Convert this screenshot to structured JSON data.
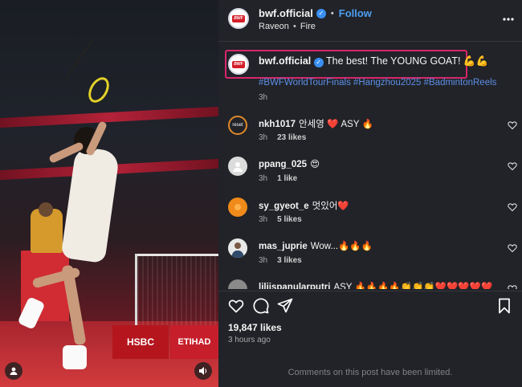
{
  "header": {
    "username": "bwf.official",
    "follow_label": "Follow",
    "audio": "Raveon",
    "audio_track": "Fire",
    "avatar_text": "BWF"
  },
  "caption": {
    "username": "bwf.official",
    "text": "The best! The YOUNG GOAT! 💪💪",
    "hashtags": "#BWFWorldTourFinals #Hangzhou2025 #BadmintonReels",
    "time": "3h"
  },
  "comments": [
    {
      "username": "nkh1017",
      "text": "안세영 ❤️ ASY 🔥",
      "time": "3h",
      "likes": "23 likes",
      "avatar_color": "#2a2a2a",
      "avatar_label": "reset"
    },
    {
      "username": "ppang_025",
      "text": "😍",
      "time": "3h",
      "likes": "1 like",
      "avatar_color": "#dcdcdc",
      "avatar_label": ""
    },
    {
      "username": "sy_gyeot_e",
      "text": "멋있어❤️",
      "time": "3h",
      "likes": "5 likes",
      "avatar_color": "#f08a1a",
      "avatar_label": ""
    },
    {
      "username": "mas_juprie",
      "text": "Wow...🔥🔥🔥",
      "time": "3h",
      "likes": "3 likes",
      "avatar_color": "#5b7c6a",
      "avatar_label": ""
    },
    {
      "username": "liliispanularputri",
      "text": "ASY 🔥🔥🔥🔥👏👏👏❤️❤️❤️❤️❤️",
      "time": "",
      "likes": "",
      "avatar_color": "#8a8a8a",
      "avatar_label": ""
    }
  ],
  "post": {
    "likes": "19,847 likes",
    "ago": "3 hours ago",
    "comments_limited": "Comments on this post have been limited."
  },
  "media": {
    "sponsor_1": "HSBC",
    "sponsor_2": "ETIHAD"
  },
  "icons": {
    "more": "more-options-icon",
    "verified": "verified-badge-icon",
    "like": "heart-icon",
    "comment": "comment-icon",
    "share": "share-icon",
    "save": "bookmark-icon",
    "tag": "user-tag-icon",
    "mute": "speaker-icon"
  },
  "colors": {
    "accent": "#4c9ff2",
    "highlight_box": "#d8266a",
    "hashtag": "#5d8fe6",
    "brand_red": "#d41f2a"
  }
}
